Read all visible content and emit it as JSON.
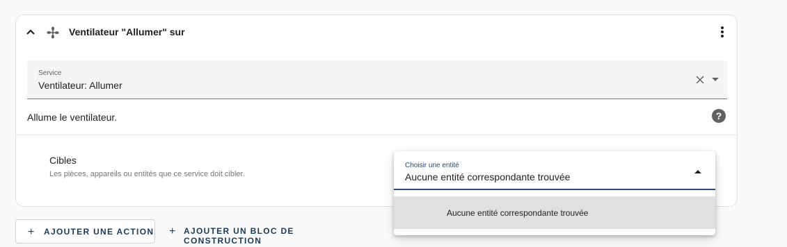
{
  "card": {
    "title": "Ventilateur \"Allumer\" sur",
    "icons": {
      "collapse": "chevron-up-icon",
      "domain": "fan-icon",
      "menu": "dots-vertical-icon"
    }
  },
  "service": {
    "label": "Service",
    "value": "Ventilateur: Allumer"
  },
  "description": "Allume le ventilateur.",
  "help_symbol": "?",
  "targets": {
    "title": "Cibles",
    "description": "Les pièces, appareils ou entités que ce service doit cibler."
  },
  "entity_picker": {
    "label": "Choisir une entité",
    "value": "Aucune entité correspondante trouvée",
    "options": [
      "Aucune entité correspondante trouvée"
    ]
  },
  "actions": {
    "add_action": "AJOUTER UNE ACTION",
    "add_block": "AJOUTER UN BLOC DE CONSTRUCTION",
    "plus_symbol": "+"
  },
  "colors": {
    "accent": "#2c4a75",
    "button_text": "#1a3a5a"
  }
}
